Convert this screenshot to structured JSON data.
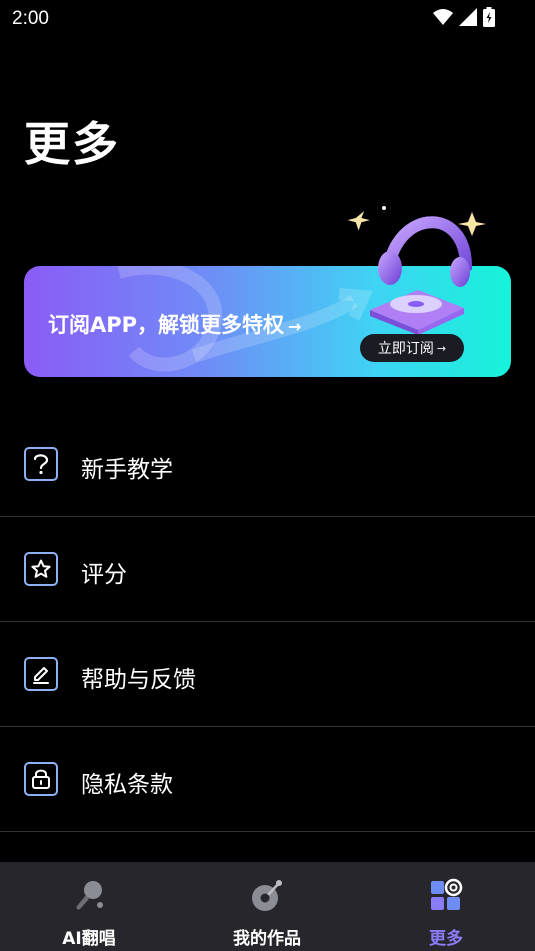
{
  "status_bar": {
    "time": "2:00"
  },
  "page": {
    "title": "更多"
  },
  "banner": {
    "text": "订阅APP，解锁更多特权",
    "arrow": "→",
    "button_label": "立即订阅",
    "button_arrow": "→"
  },
  "menu": {
    "items": [
      {
        "label": "新手教学",
        "icon": "question-icon"
      },
      {
        "label": "评分",
        "icon": "star-icon"
      },
      {
        "label": "帮助与反馈",
        "icon": "edit-icon"
      },
      {
        "label": "隐私条款",
        "icon": "lock-icon"
      }
    ]
  },
  "tabs": [
    {
      "label": "AI翻唱",
      "icon": "microphone-icon",
      "active": false
    },
    {
      "label": "我的作品",
      "icon": "record-icon",
      "active": false
    },
    {
      "label": "更多",
      "icon": "more-icon",
      "active": true
    }
  ],
  "colors": {
    "accent": "#8b7cf8",
    "icon_border": "#8fb0f4",
    "tab_bar_bg": "#26262c"
  }
}
